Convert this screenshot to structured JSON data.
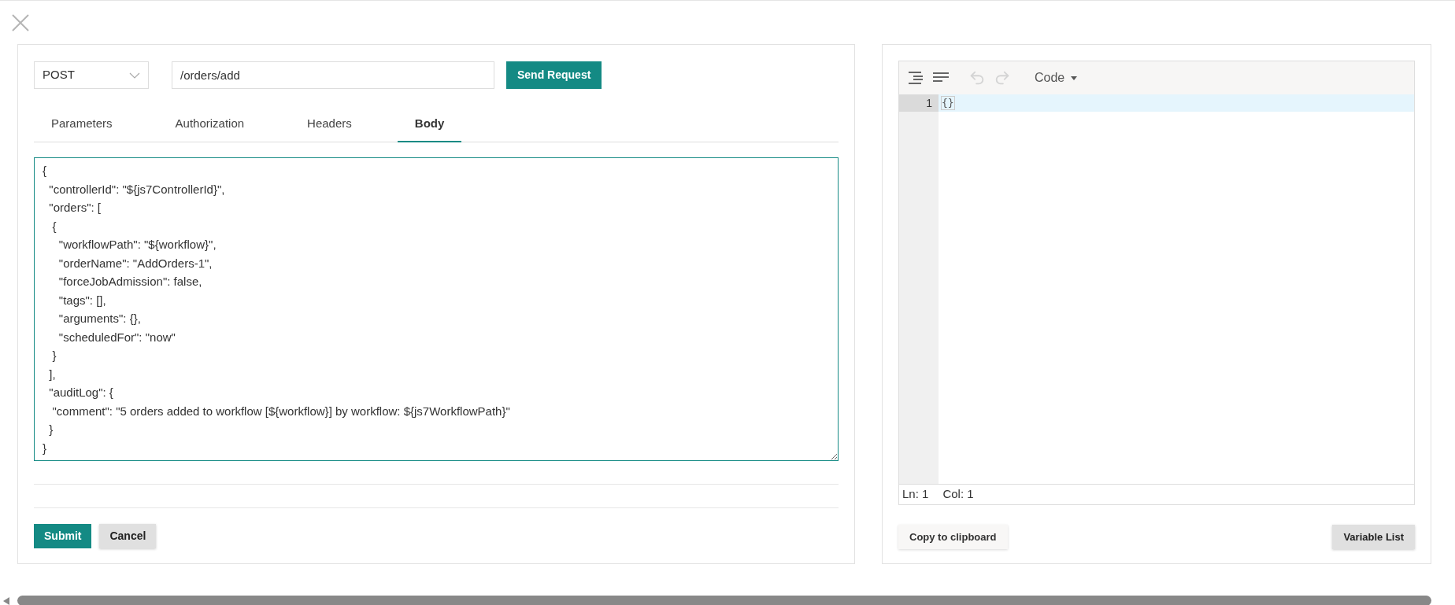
{
  "request": {
    "method": "POST",
    "url": "/orders/add",
    "send_button": "Send Request"
  },
  "tabs": [
    {
      "label": "Parameters",
      "selected": false
    },
    {
      "label": "Authorization",
      "selected": false
    },
    {
      "label": "Headers",
      "selected": false
    },
    {
      "label": "Body",
      "selected": true
    }
  ],
  "body": "{\n  \"controllerId\": \"${js7ControllerId}\",\n  \"orders\": [\n   {\n     \"workflowPath\": \"${workflow}\",\n     \"orderName\": \"AddOrders-1\",\n     \"forceJobAdmission\": false,\n     \"tags\": [],\n     \"arguments\": {},\n     \"scheduledFor\": \"now\"\n   }\n  ],\n  \"auditLog\": {\n   \"comment\": \"5 orders added to workflow [${workflow}] by workflow: ${js7WorkflowPath}\"\n  }\n}",
  "form_buttons": {
    "submit": "Submit",
    "cancel": "Cancel"
  },
  "editor": {
    "mode": "Code",
    "undo_disabled": true,
    "redo_disabled": true,
    "lines": [
      {
        "number": "1",
        "text": "{}",
        "active": true
      }
    ],
    "status": {
      "line": "Ln: 1",
      "column": "Col: 1"
    }
  },
  "editor_buttons": {
    "copy": "Copy to clipboard",
    "variables": "Variable List"
  }
}
